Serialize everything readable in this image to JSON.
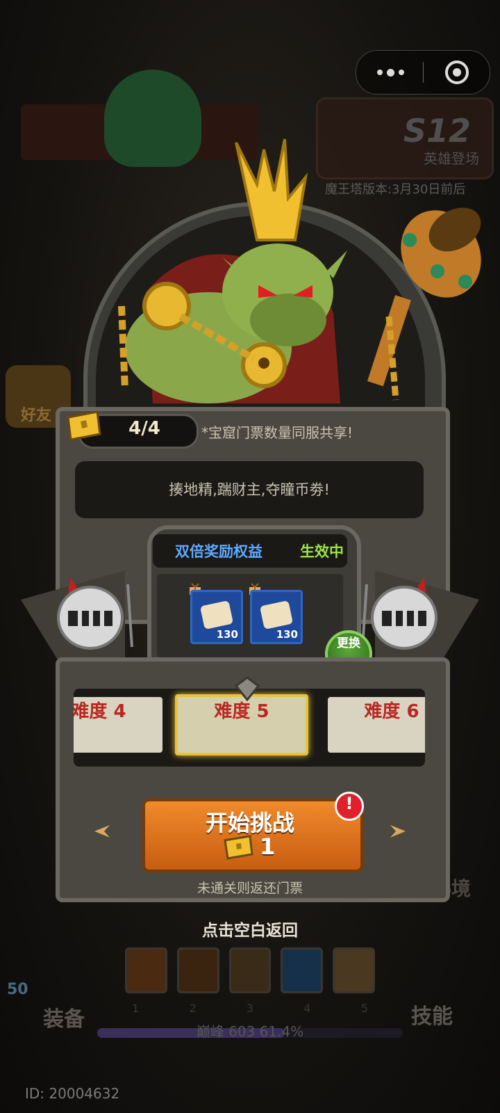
{
  "topbar": {
    "menu_icon": "more-dots-icon",
    "close_icon": "target-circle-icon"
  },
  "background": {
    "season_badge": "S12",
    "season_subtitle": "英雄登场",
    "version_note": "魔王塔版本:3月30日前后",
    "friends_label": "好友",
    "secret_label": "秘境",
    "equip_label": "装备",
    "skill_label": "技能",
    "level_badge": "50",
    "skill_slots": [
      "1",
      "2",
      "3",
      "4",
      "5"
    ],
    "peak_text": "巅峰 603  61.4%",
    "peak_progress": 0.614,
    "user_id": "ID: 20004632"
  },
  "modal": {
    "ticket_count": "4/4",
    "share_note": "*宝窟门票数量同服共享!",
    "slogan": "揍地精,踹财主,夺瞳币劵!",
    "reward": {
      "title": "双倍奖励权益",
      "status": "生效中",
      "items": [
        {
          "icon": "ticket-scroll-icon",
          "qty": "130"
        },
        {
          "icon": "ticket-scroll-icon",
          "qty": "130"
        }
      ],
      "swap_label": "更换"
    },
    "difficulties": [
      {
        "label": "难度 4",
        "selected": false
      },
      {
        "label": "难度 5",
        "selected": true
      },
      {
        "label": "难度 6",
        "selected": false
      }
    ],
    "start_button": {
      "label": "开始挑战",
      "cost": "1",
      "alert": "!"
    },
    "refund_note": "未通关则返还门票",
    "back_hint": "点击空白返回"
  },
  "colors": {
    "accent_orange": "#e57a22",
    "reward_blue": "#5fa8ff",
    "active_green": "#9ee24f",
    "difficulty_red": "#b82822",
    "selected_gold": "#e8c33a"
  }
}
